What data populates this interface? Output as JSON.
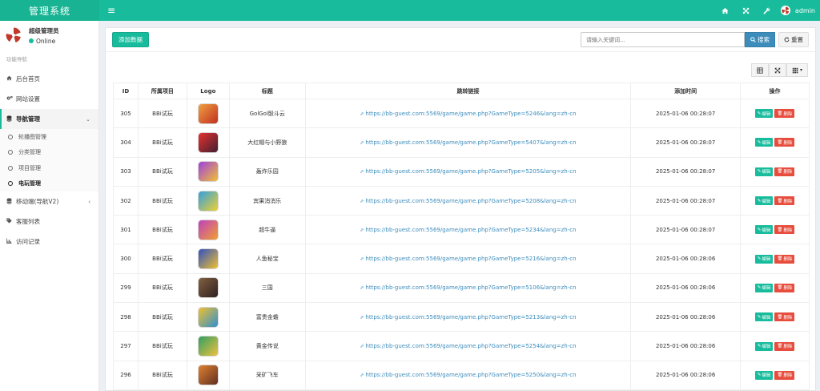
{
  "header": {
    "brand": "管理系统",
    "menu_icon": "≡",
    "admin_name": "admin",
    "icons": [
      "home-icon",
      "expand-icon",
      "wrench-icon"
    ]
  },
  "sidebar": {
    "user_name": "超级管理员",
    "user_status": "Online",
    "nav_header": "功能导航",
    "items": [
      {
        "label": "后台首页",
        "icon": "home-icon"
      },
      {
        "label": "网站设置",
        "icon": "gears-icon"
      },
      {
        "label": "导航管理",
        "icon": "database-icon",
        "open": true,
        "children": [
          {
            "label": "轮播图管理"
          },
          {
            "label": "分类管理"
          },
          {
            "label": "项目管理"
          },
          {
            "label": "电玩管理",
            "active": true
          }
        ]
      },
      {
        "label": "移动端(导航V2)",
        "icon": "database-icon"
      },
      {
        "label": "客服列表",
        "icon": "tag-icon"
      },
      {
        "label": "访问记录",
        "icon": "chart-icon"
      }
    ]
  },
  "toolbar": {
    "add_label": "添加数据",
    "search_placeholder": "请输入关键词...",
    "search_label": "搜索",
    "reset_label": "重置"
  },
  "table": {
    "headers": [
      "ID",
      "所属项目",
      "Logo",
      "标题",
      "跳转链接",
      "添加时间",
      "操作"
    ],
    "edit_label": "编辑",
    "delete_label": "删除",
    "rows": [
      {
        "id": "305",
        "project": "BBi试玩",
        "title": "GolGol骰斗云",
        "link": "https://bb-guest.com:5569/game/game.php?GameType=5246&lang=zh-cn",
        "time": "2025-01-06 00:28:07",
        "logo_colors": [
          "#f0a040",
          "#c03020"
        ]
      },
      {
        "id": "304",
        "project": "BBi试玩",
        "title": "大红帽与小野狼",
        "link": "https://bb-guest.com:5569/game/game.php?GameType=5407&lang=zh-cn",
        "time": "2025-01-06 00:28:07",
        "logo_colors": [
          "#e83030",
          "#402030"
        ]
      },
      {
        "id": "303",
        "project": "BBi试玩",
        "title": "轰炸乐园",
        "link": "https://bb-guest.com:5569/game/game.php?GameType=5205&lang=zh-cn",
        "time": "2025-01-06 00:28:07",
        "logo_colors": [
          "#a040e0",
          "#f0c030"
        ]
      },
      {
        "id": "302",
        "project": "BBi试玩",
        "title": "宾果消消乐",
        "link": "https://bb-guest.com:5569/game/game.php?GameType=5208&lang=zh-cn",
        "time": "2025-01-06 00:28:07",
        "logo_colors": [
          "#30a0e0",
          "#f0d030"
        ]
      },
      {
        "id": "301",
        "project": "BBi试玩",
        "title": "超牛逼",
        "link": "https://bb-guest.com:5569/game/game.php?GameType=5234&lang=zh-cn",
        "time": "2025-01-06 00:28:07",
        "logo_colors": [
          "#c040c0",
          "#f0a030"
        ]
      },
      {
        "id": "300",
        "project": "BBi试玩",
        "title": "人鱼秘宝",
        "link": "https://bb-guest.com:5569/game/game.php?GameType=5216&lang=zh-cn",
        "time": "2025-01-06 00:28:06",
        "logo_colors": [
          "#3050c0",
          "#f0c030"
        ]
      },
      {
        "id": "299",
        "project": "BBi试玩",
        "title": "三国",
        "link": "https://bb-guest.com:5569/game/game.php?GameType=5106&lang=zh-cn",
        "time": "2025-01-06 00:28:06",
        "logo_colors": [
          "#806040",
          "#302020"
        ]
      },
      {
        "id": "298",
        "project": "BBi试玩",
        "title": "富贵金蟾",
        "link": "https://bb-guest.com:5569/game/game.php?GameType=5213&lang=zh-cn",
        "time": "2025-01-06 00:28:06",
        "logo_colors": [
          "#f0c030",
          "#3090d0"
        ]
      },
      {
        "id": "297",
        "project": "BBi试玩",
        "title": "黄金传说",
        "link": "https://bb-guest.com:5569/game/game.php?GameType=5254&lang=zh-cn",
        "time": "2025-01-06 00:28:06",
        "logo_colors": [
          "#30a060",
          "#f0c040"
        ]
      },
      {
        "id": "296",
        "project": "BBi试玩",
        "title": "采矿飞车",
        "link": "https://bb-guest.com:5569/game/game.php?GameType=5250&lang=zh-cn",
        "time": "2025-01-06 00:28:06",
        "logo_colors": [
          "#e08030",
          "#603020"
        ]
      }
    ]
  },
  "colors": {
    "brand": "#18bc9c",
    "primary": "#3c8dbc",
    "danger": "#e74c3c"
  }
}
